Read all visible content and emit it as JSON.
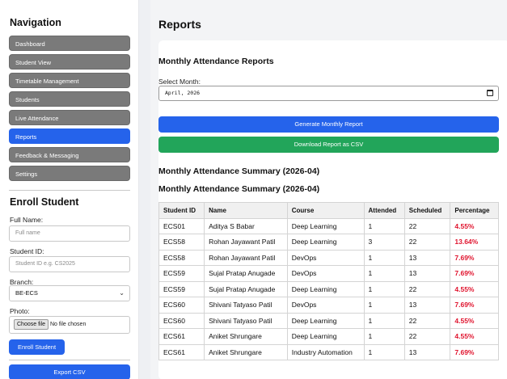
{
  "sidebar": {
    "nav_title": "Navigation",
    "nav_items": [
      {
        "label": "Dashboard",
        "active": false
      },
      {
        "label": "Student View",
        "active": false
      },
      {
        "label": "Timetable Management",
        "active": false
      },
      {
        "label": "Students",
        "active": false
      },
      {
        "label": "Live Attendance",
        "active": false
      },
      {
        "label": "Reports",
        "active": true
      },
      {
        "label": "Feedback & Messaging",
        "active": false
      },
      {
        "label": "Settings",
        "active": false
      }
    ],
    "enroll": {
      "title": "Enroll Student",
      "full_name_label": "Full Name:",
      "full_name_placeholder": "Full name",
      "student_id_label": "Student ID:",
      "student_id_placeholder": "Student ID e.g. CS2025",
      "branch_label": "Branch:",
      "branch_value": "BE-ECS",
      "photo_label": "Photo:",
      "choose_file_label": "Choose file",
      "no_file_text": "No file chosen",
      "enroll_button": "Enroll Student"
    },
    "export_button": "Export CSV"
  },
  "main": {
    "page_title": "Reports",
    "card_title": "Monthly Attendance Reports",
    "select_month_label": "Select Month:",
    "month_value": "April, 2026",
    "generate_button": "Generate Monthly Report",
    "download_button": "Download Report as CSV",
    "summary_title_1": "Monthly Attendance Summary (2026-04)",
    "summary_title_2": "Monthly Attendance Summary (2026-04)",
    "table": {
      "headers": [
        "Student ID",
        "Name",
        "Course",
        "Attended",
        "Scheduled",
        "Percentage"
      ],
      "rows": [
        [
          "ECS01",
          "Aditya S Babar",
          "Deep Learning",
          "1",
          "22",
          "4.55%"
        ],
        [
          "ECS58",
          "Rohan Jayawant Patil",
          "Deep Learning",
          "3",
          "22",
          "13.64%"
        ],
        [
          "ECS58",
          "Rohan Jayawant Patil",
          "DevOps",
          "1",
          "13",
          "7.69%"
        ],
        [
          "ECS59",
          "Sujal Pratap Anugade",
          "DevOps",
          "1",
          "13",
          "7.69%"
        ],
        [
          "ECS59",
          "Sujal Pratap Anugade",
          "Deep Learning",
          "1",
          "22",
          "4.55%"
        ],
        [
          "ECS60",
          "Shivani Tatyaso Patil",
          "DevOps",
          "1",
          "13",
          "7.69%"
        ],
        [
          "ECS60",
          "Shivani Tatyaso Patil",
          "Deep Learning",
          "1",
          "22",
          "4.55%"
        ],
        [
          "ECS61",
          "Aniket Shrungare",
          "Deep Learning",
          "1",
          "22",
          "4.55%"
        ],
        [
          "ECS61",
          "Aniket Shrungare",
          "Industry Automation",
          "1",
          "13",
          "7.69%"
        ]
      ]
    }
  },
  "colors": {
    "nav_inactive": "#7a7a7a",
    "nav_active": "#2563eb",
    "primary_button": "#2563eb",
    "csv_button": "#22a55a",
    "percentage_text": "#e0142e"
  }
}
